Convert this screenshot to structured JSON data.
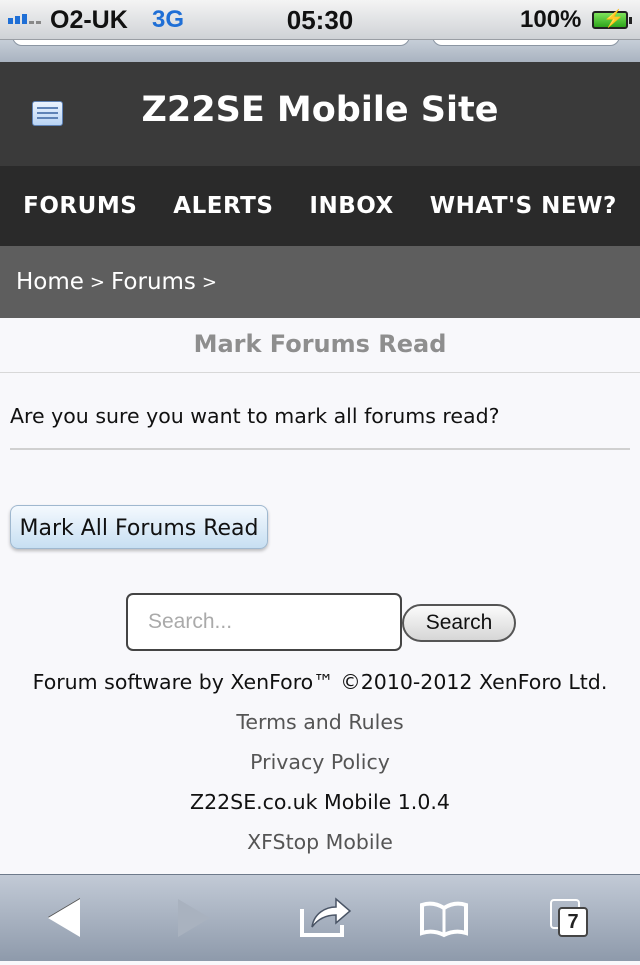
{
  "status_bar": {
    "carrier": "O2-UK",
    "network": "3G",
    "time": "05:30",
    "battery_percent": "100%",
    "icons": [
      "signal-icon",
      "battery-charging-icon"
    ]
  },
  "header": {
    "title": "Z22SE Mobile Site",
    "menu_icon": "list-icon"
  },
  "nav": {
    "items": [
      {
        "label": "FORUMS"
      },
      {
        "label": "ALERTS"
      },
      {
        "label": "INBOX"
      },
      {
        "label": "WHAT'S NEW?"
      }
    ]
  },
  "breadcrumb": {
    "items": [
      {
        "label": "Home"
      },
      {
        "label": "Forums"
      }
    ],
    "separator": ">"
  },
  "main": {
    "section_title": "Mark Forums Read",
    "confirm_text": "Are you sure you want to mark all forums read?",
    "mark_button_label": "Mark All Forums Read"
  },
  "search": {
    "placeholder": "Search...",
    "button_label": "Search"
  },
  "footer": {
    "copyright": "Forum software by XenForo™ ©2010-2012 XenForo Ltd.",
    "terms": "Terms and Rules",
    "privacy": "Privacy Policy",
    "version": "Z22SE.co.uk Mobile 1.0.4",
    "xfstop": "XFStop Mobile"
  },
  "toolbar": {
    "items": [
      {
        "icon": "back-arrow-icon"
      },
      {
        "icon": "forward-arrow-icon"
      },
      {
        "icon": "share-icon"
      },
      {
        "icon": "bookmarks-icon"
      },
      {
        "icon": "tabs-icon"
      }
    ],
    "tab_count": "7"
  },
  "colors": {
    "header_bg": "#3a3a3a",
    "nav_bg": "#2a2a2a",
    "breadcrumb_bg": "#5e5e5e",
    "page_bg": "#f8f8fb",
    "button_blue": "#c7dff2"
  }
}
